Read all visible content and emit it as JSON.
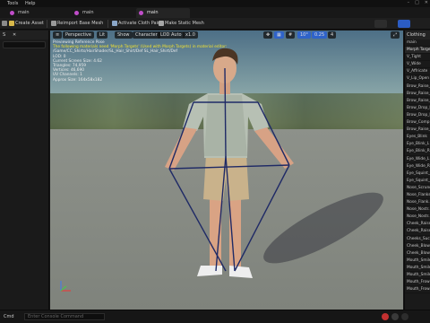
{
  "menu": {
    "tools": "Tools",
    "help": "Help"
  },
  "tabs": [
    {
      "label": "main"
    },
    {
      "label": "main"
    },
    {
      "label": "main"
    }
  ],
  "toolbar": {
    "create_asset": "Create Asset",
    "reimport": "Reimport Base Mesh",
    "activate_cloth": "Activate Cloth Paint",
    "make_static": "Make Static Mesh"
  },
  "viewport": {
    "perspective": "Perspective",
    "lit": "Lit",
    "show": "Show",
    "character": "Character",
    "lod_auto": "LOD Auto",
    "speed": "x1.0",
    "angle": "10°",
    "scale": "0.25",
    "cam": "4",
    "info_lines": [
      "Previewing Reference Pose",
      "The following materials need 'Morph Targets' (Used with Morph Targets) in material editor:",
      "/Game/CC_Shirts/HairShader/SL_Hair_Shirt/Def SL_Hair_Shirt/Def",
      "LOD: 0",
      "Current Screen Size: 4.62",
      "Triangles: 74,959",
      "Vertices: 46,690",
      "UV Channels: 1",
      "Approx Size: 164x58x182"
    ]
  },
  "left_panel": {
    "title": "S"
  },
  "right_panel": {
    "tab": "Clothing",
    "header": "Morph Target",
    "sub": "main",
    "items": [
      "V_Tight",
      "V_Wide",
      "V_Affricate",
      "V_Lip_Open",
      "Brow_Raise_...",
      "Brow_Raise_...",
      "Brow_Raise_...",
      "Brow_Drop_L",
      "Brow_Drop_R",
      "Brow_Comp...",
      "Brow_Raise_...",
      "Eyes_Blink",
      "Eye_Blink_L",
      "Eye_Blink_R",
      "Eye_Wide_L",
      "Eye_Wide_R",
      "Eye_Squint_L",
      "Eye_Squint_R",
      "Nose_Scrunch",
      "Nose_Flanks...",
      "Nose_Flank...",
      "Nose_Nostr...",
      "Nose_Nostr...",
      "Cheek_Raise...",
      "Cheek_Raise...",
      "Cheeks_Suck",
      "Cheek_Blow...",
      "Cheek_Blow...",
      "Mouth_Smile",
      "Mouth_Smile...",
      "Mouth_Smile...",
      "Mouth_Frown",
      "Mouth_Frow..."
    ]
  },
  "bottom": {
    "cmd": "Cmd",
    "placeholder": "Enter Console Command"
  },
  "colors": {
    "accent": "#2f63c9",
    "warning": "#f2e230",
    "tab_icon": "#c04dc9"
  }
}
